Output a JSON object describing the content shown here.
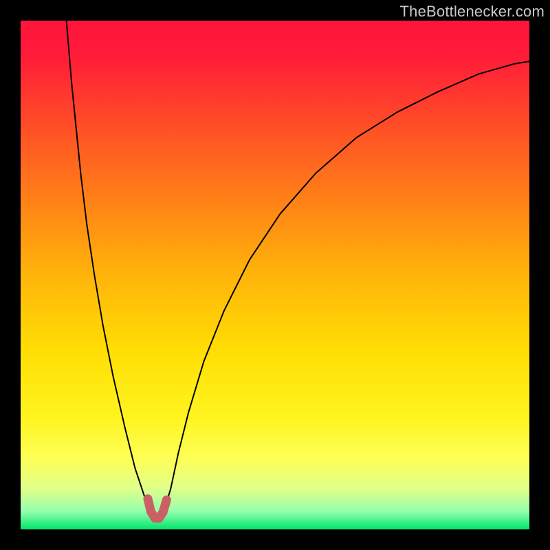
{
  "watermark": "TheBottlenecker.com",
  "chart_data": {
    "type": "line",
    "title": "",
    "xlabel": "",
    "ylabel": "",
    "xlim": [
      0,
      1
    ],
    "ylim": [
      0,
      1
    ],
    "grid": false,
    "gradient_stops": [
      {
        "offset": 0.0,
        "color": "#ff143c"
      },
      {
        "offset": 0.07,
        "color": "#ff1c39"
      },
      {
        "offset": 0.2,
        "color": "#ff4b27"
      },
      {
        "offset": 0.35,
        "color": "#ff8017"
      },
      {
        "offset": 0.5,
        "color": "#ffb40a"
      },
      {
        "offset": 0.65,
        "color": "#ffde04"
      },
      {
        "offset": 0.78,
        "color": "#fff41f"
      },
      {
        "offset": 0.86,
        "color": "#fdff56"
      },
      {
        "offset": 0.92,
        "color": "#e0ff8a"
      },
      {
        "offset": 0.965,
        "color": "#93ffae"
      },
      {
        "offset": 1.0,
        "color": "#00e66a"
      }
    ],
    "series": [
      {
        "name": "curve-left",
        "color": "#000000",
        "width": 2,
        "points": [
          {
            "x": 0.09,
            "y": 1.0
          },
          {
            "x": 0.095,
            "y": 0.94
          },
          {
            "x": 0.1,
            "y": 0.88
          },
          {
            "x": 0.108,
            "y": 0.8
          },
          {
            "x": 0.118,
            "y": 0.7
          },
          {
            "x": 0.13,
            "y": 0.6
          },
          {
            "x": 0.145,
            "y": 0.5
          },
          {
            "x": 0.162,
            "y": 0.4
          },
          {
            "x": 0.182,
            "y": 0.3
          },
          {
            "x": 0.205,
            "y": 0.2
          },
          {
            "x": 0.225,
            "y": 0.12
          },
          {
            "x": 0.245,
            "y": 0.06
          },
          {
            "x": 0.258,
            "y": 0.03
          },
          {
            "x": 0.268,
            "y": 0.02
          },
          {
            "x": 0.275,
            "y": 0.022
          },
          {
            "x": 0.283,
            "y": 0.04
          },
          {
            "x": 0.295,
            "y": 0.08
          },
          {
            "x": 0.31,
            "y": 0.15
          },
          {
            "x": 0.33,
            "y": 0.23
          },
          {
            "x": 0.36,
            "y": 0.33
          },
          {
            "x": 0.4,
            "y": 0.43
          },
          {
            "x": 0.45,
            "y": 0.53
          },
          {
            "x": 0.51,
            "y": 0.62
          },
          {
            "x": 0.58,
            "y": 0.7
          },
          {
            "x": 0.66,
            "y": 0.77
          },
          {
            "x": 0.74,
            "y": 0.82
          },
          {
            "x": 0.82,
            "y": 0.86
          },
          {
            "x": 0.9,
            "y": 0.895
          },
          {
            "x": 0.97,
            "y": 0.915
          },
          {
            "x": 1.0,
            "y": 0.92
          }
        ]
      },
      {
        "name": "highlight-arc",
        "color": "#cb6064",
        "width": 13,
        "linecap": "round",
        "points": [
          {
            "x": 0.25,
            "y": 0.06
          },
          {
            "x": 0.256,
            "y": 0.035
          },
          {
            "x": 0.264,
            "y": 0.022
          },
          {
            "x": 0.272,
            "y": 0.022
          },
          {
            "x": 0.28,
            "y": 0.034
          },
          {
            "x": 0.287,
            "y": 0.058
          }
        ]
      }
    ]
  }
}
